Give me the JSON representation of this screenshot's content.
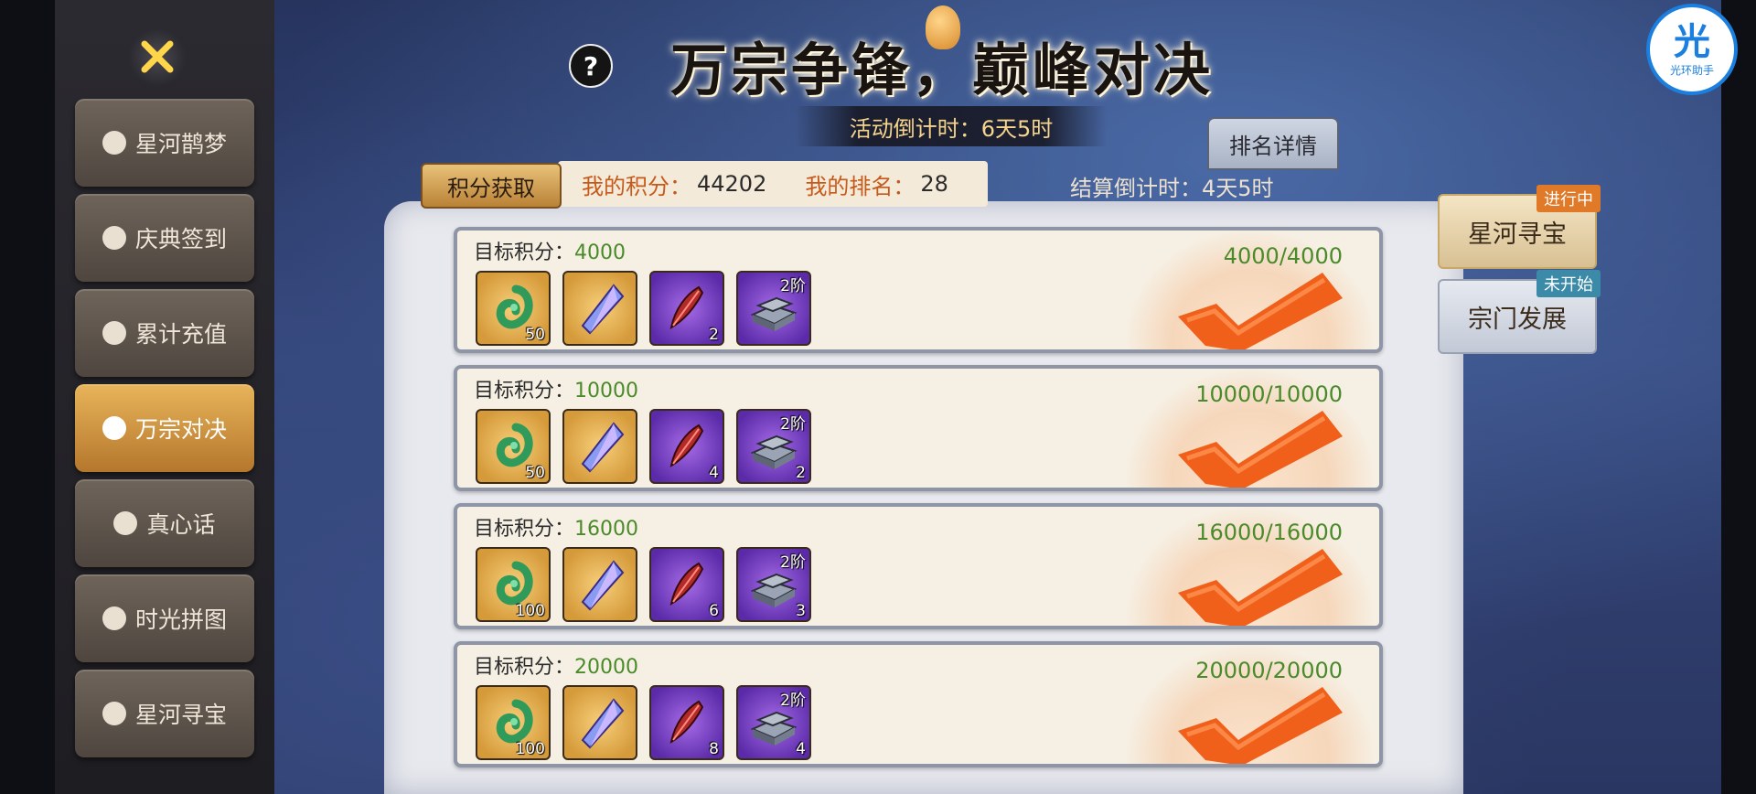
{
  "header": {
    "title": "万宗争锋，巅峰对决",
    "countdown_label": "活动倒计时：",
    "countdown_value": "6天5时",
    "rank_detail_label": "排名详情",
    "help_label": "?"
  },
  "sidebar": {
    "items": [
      {
        "label": "星河鹊梦"
      },
      {
        "label": "庆典签到"
      },
      {
        "label": "累计充值"
      },
      {
        "label": "万宗对决"
      },
      {
        "label": "真心话"
      },
      {
        "label": "时光拼图"
      },
      {
        "label": "星河寻宝"
      }
    ],
    "active_index": 3
  },
  "score": {
    "tab_label": "积分获取",
    "my_score_label": "我的积分：",
    "my_score_value": "44202",
    "my_rank_label": "我的排名：",
    "my_rank_value": "28",
    "settle_label": "结算倒计时：",
    "settle_value": "4天5时"
  },
  "rewards": [
    {
      "target_label": "目标积分：",
      "target": "4000",
      "progress": "4000/4000",
      "items": [
        {
          "icon": "jade-pendant-icon",
          "count": "50"
        },
        {
          "icon": "crystal-shard-icon",
          "count": ""
        },
        {
          "icon": "red-feather-icon",
          "count": "2"
        },
        {
          "icon": "iron-ingot-icon",
          "count": "",
          "tier": "2阶"
        }
      ]
    },
    {
      "target_label": "目标积分：",
      "target": "10000",
      "progress": "10000/10000",
      "items": [
        {
          "icon": "jade-pendant-icon",
          "count": "50"
        },
        {
          "icon": "crystal-shard-icon",
          "count": ""
        },
        {
          "icon": "red-feather-icon",
          "count": "4"
        },
        {
          "icon": "iron-ingot-icon",
          "count": "2",
          "tier": "2阶"
        }
      ]
    },
    {
      "target_label": "目标积分：",
      "target": "16000",
      "progress": "16000/16000",
      "items": [
        {
          "icon": "jade-pendant-icon",
          "count": "100"
        },
        {
          "icon": "crystal-shard-icon",
          "count": ""
        },
        {
          "icon": "red-feather-icon",
          "count": "6"
        },
        {
          "icon": "iron-ingot-icon",
          "count": "3",
          "tier": "2阶"
        }
      ]
    },
    {
      "target_label": "目标积分：",
      "target": "20000",
      "progress": "20000/20000",
      "items": [
        {
          "icon": "jade-pendant-icon",
          "count": "100"
        },
        {
          "icon": "crystal-shard-icon",
          "count": ""
        },
        {
          "icon": "red-feather-icon",
          "count": "8"
        },
        {
          "icon": "iron-ingot-icon",
          "count": "4",
          "tier": "2阶"
        }
      ]
    }
  ],
  "events": [
    {
      "label": "星河寻宝",
      "status": "进行中"
    },
    {
      "label": "宗门发展",
      "status": "未开始"
    }
  ],
  "overlay": {
    "logo_big": "光",
    "logo_small": "光环助手"
  },
  "colors": {
    "accent_gold": "#e8b45a",
    "progress_green": "#4a8a2a",
    "check_orange": "#f0601a",
    "label_orange": "#c55a1a"
  }
}
